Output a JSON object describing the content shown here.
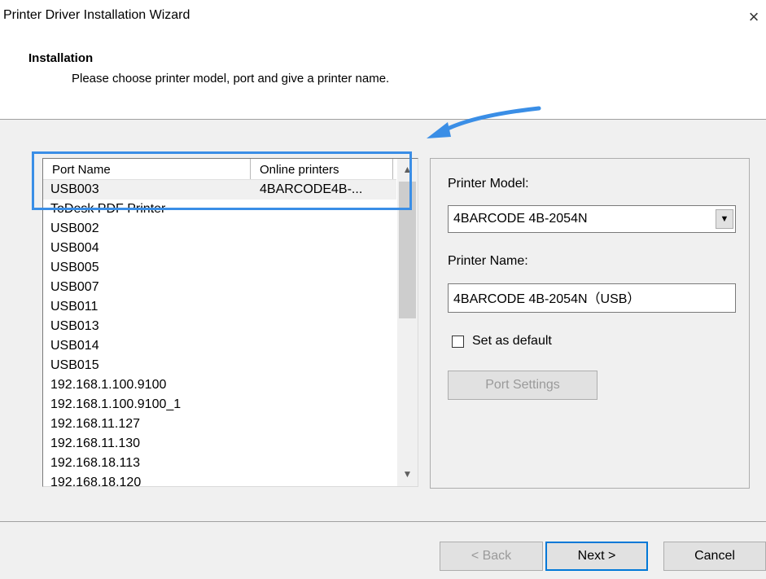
{
  "window": {
    "title": "Printer Driver Installation Wizard",
    "close_glyph": "×"
  },
  "header": {
    "title": "Installation",
    "subtitle": "Please choose printer model, port and give a printer name."
  },
  "port_list": {
    "columns": [
      "Port Name",
      "Online printers"
    ],
    "rows": [
      {
        "port": "USB003",
        "printer": "4BARCODE4B-..."
      },
      {
        "port": "ToDesk PDF Printer",
        "printer": ""
      },
      {
        "port": "USB002",
        "printer": ""
      },
      {
        "port": "USB004",
        "printer": ""
      },
      {
        "port": "USB005",
        "printer": ""
      },
      {
        "port": "USB007",
        "printer": ""
      },
      {
        "port": "USB011",
        "printer": ""
      },
      {
        "port": "USB013",
        "printer": ""
      },
      {
        "port": "USB014",
        "printer": ""
      },
      {
        "port": "USB015",
        "printer": ""
      },
      {
        "port": "192.168.1.100.9100",
        "printer": ""
      },
      {
        "port": "192.168.1.100.9100_1",
        "printer": ""
      },
      {
        "port": "192.168.11.127",
        "printer": ""
      },
      {
        "port": "192.168.11.130",
        "printer": ""
      },
      {
        "port": "192.168.18.113",
        "printer": ""
      },
      {
        "port": "192.168.18.120",
        "printer": ""
      }
    ],
    "selected_index": 0
  },
  "settings": {
    "model_label": "Printer Model:",
    "model_value": "4BARCODE 4B-2054N",
    "name_label": "Printer Name:",
    "name_value": "4BARCODE 4B-2054N（USB）",
    "default_label": "Set as default",
    "default_checked": false,
    "port_settings_label": "Port Settings"
  },
  "footer": {
    "back_label": "< Back",
    "next_label": "Next >",
    "cancel_label": "Cancel"
  },
  "colors": {
    "annotation": "#3a8ee6",
    "focus_border": "#0078d7"
  }
}
